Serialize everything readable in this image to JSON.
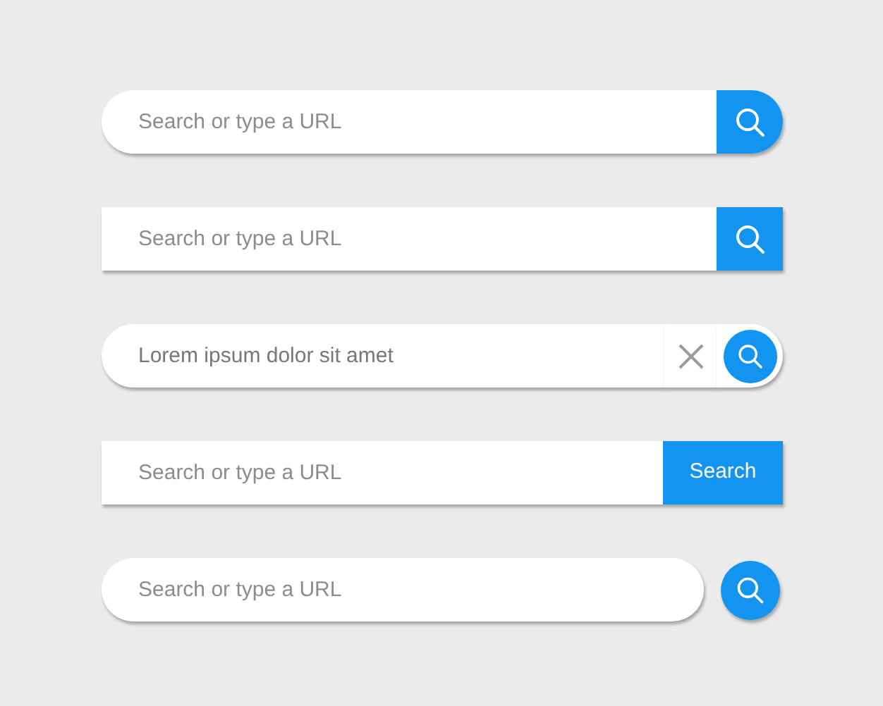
{
  "search_bars": [
    {
      "kind": "pill",
      "placeholder": "Search or type a URL"
    },
    {
      "kind": "square",
      "placeholder": "Search or type a URL"
    },
    {
      "kind": "pill_clear",
      "value": "Lorem ipsum dolor sit amet"
    },
    {
      "kind": "square_text",
      "placeholder": "Search or type a URL",
      "button_label": "Search"
    },
    {
      "kind": "pill_separate",
      "placeholder": "Search or type a URL"
    }
  ]
}
